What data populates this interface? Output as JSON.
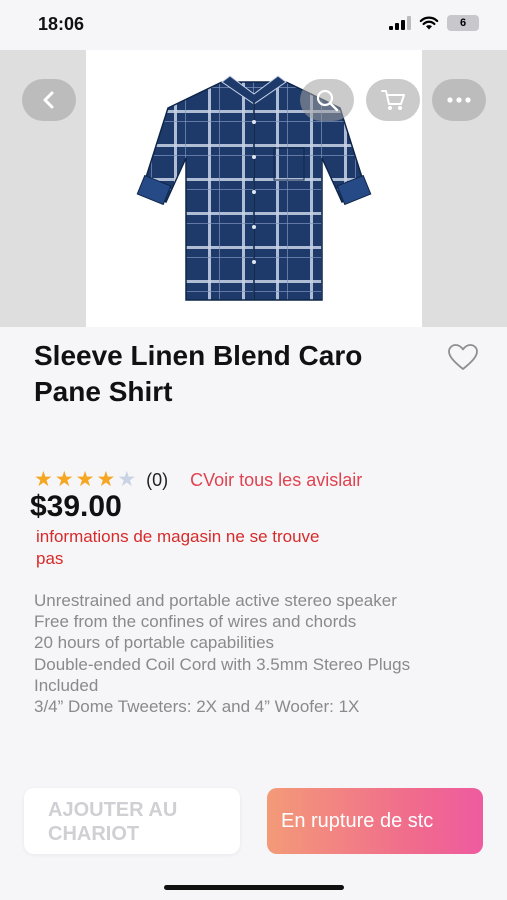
{
  "status_bar": {
    "time": "18:06",
    "battery": "6"
  },
  "product": {
    "title": "Sleeve Linen Blend Caro Pane Shirt",
    "rating": 4,
    "max_rating": 5,
    "review_count": "(0)",
    "see_reviews_label": "CVoir tous les avislair",
    "price": "$39.00",
    "store_info": "informations de magasin ne se trouve pas",
    "description": [
      "Unrestrained and portable active stereo speaker",
      "Free from the confines of wires and chords",
      "20 hours of portable capabilities",
      "Double-ended Coil Cord with 3.5mm Stereo Plugs Included",
      "3/4” Dome Tweeters: 2X and 4” Woofer: 1X"
    ]
  },
  "actions": {
    "add_to_cart_label": "AJOUTER AU CHARIOT",
    "out_of_stock_label": "En rupture de stc"
  },
  "icons": {
    "back": "back-chevron-icon",
    "search": "search-icon",
    "cart": "cart-icon",
    "more": "more-dots-icon",
    "favorite": "heart-outline-icon"
  },
  "colors": {
    "star_filled": "#f5a623",
    "star_empty": "#c9d3e3",
    "link_red": "#e0424f",
    "store_info_red": "#d72a2a",
    "gradient_start": "#f39a78",
    "gradient_end": "#ee5ba0"
  }
}
